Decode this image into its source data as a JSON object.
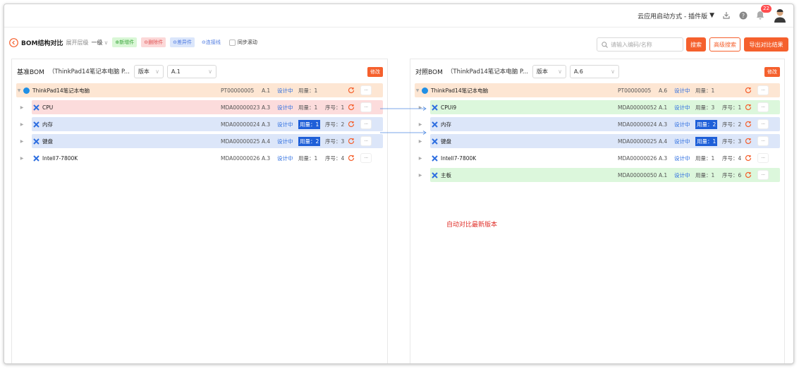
{
  "topbar": {
    "launch_label": "云应用启动方式 - 插件版",
    "notification_count": "22"
  },
  "toolbar": {
    "title": "BOM结构对比",
    "expand_level_label": "展开层级",
    "expand_level_value": "一级",
    "legend_new": "⊕新增件",
    "legend_delete": "⊖删除件",
    "legend_diff": "⊖差异件",
    "legend_line": "⊖连接线",
    "sync_scroll": "同步滚动",
    "search_placeholder": "请输入编码/名称",
    "search_btn": "搜索",
    "advanced_search_btn": "高级搜索",
    "export_btn": "导出对比结果"
  },
  "left": {
    "title": "基准BOM",
    "product": "（ThinkPad14笔记本电脑",
    "product_trunc": "P...",
    "version_label": "版本",
    "version_value": "A.1",
    "edit": "修改",
    "rows": [
      {
        "name": "ThinkPad14笔记本电脑",
        "code": "PT00000005",
        "ver": "A.1",
        "status": "设计中",
        "qty": "用量：1",
        "seq": "",
        "type": "root"
      },
      {
        "name": "CPU",
        "code": "MDA00000023",
        "ver": "A.3",
        "status": "设计中",
        "qty": "用量：1",
        "seq": "序号：1",
        "type": "del"
      },
      {
        "name": "内存",
        "code": "MDA00000024",
        "ver": "A.3",
        "status": "设计中",
        "qty": "用量：1",
        "seq": "序号：2",
        "type": "diff"
      },
      {
        "name": "键盘",
        "code": "MDA00000025",
        "ver": "A.4",
        "status": "设计中",
        "qty": "用量：2",
        "seq": "序号：3",
        "type": "diff"
      },
      {
        "name": "Intell7-7800K",
        "code": "MDA00000026",
        "ver": "A.3",
        "status": "设计中",
        "qty": "用量：1",
        "seq": "序号：4",
        "type": "none"
      }
    ]
  },
  "right": {
    "title": "对照BOM",
    "product": "（ThinkPad14笔记本电脑",
    "product_trunc": "P...",
    "version_label": "版本",
    "version_value": "A.6",
    "edit": "修改",
    "rows": [
      {
        "name": "ThinkPad14笔记本电脑",
        "code": "PT00000005",
        "ver": "A.6",
        "status": "设计中",
        "qty": "用量：1",
        "seq": "",
        "type": "root"
      },
      {
        "name": "CPUi9",
        "code": "MDA00000052",
        "ver": "A.1",
        "status": "设计中",
        "qty": "用量：3",
        "seq": "序号：1",
        "type": "new"
      },
      {
        "name": "内存",
        "code": "MDA00000024",
        "ver": "A.3",
        "status": "设计中",
        "qty": "用量：2",
        "seq": "序号：2",
        "type": "diff"
      },
      {
        "name": "键盘",
        "code": "MDA00000025",
        "ver": "A.4",
        "status": "设计中",
        "qty": "用量：1",
        "seq": "序号：3",
        "type": "diff"
      },
      {
        "name": "Intell7-7800K",
        "code": "MDA00000026",
        "ver": "A.3",
        "status": "设计中",
        "qty": "用量：1",
        "seq": "序号：4",
        "type": "none"
      },
      {
        "name": "主板",
        "code": "MDA00000050",
        "ver": "A.1",
        "status": "设计中",
        "qty": "用量：1",
        "seq": "序号：6",
        "type": "new"
      }
    ]
  },
  "annotation": "自动对比最新版本",
  "colors": {
    "accent": "#f5602d",
    "highlight": "#1e5fd8",
    "annotation": "#e0302a"
  }
}
